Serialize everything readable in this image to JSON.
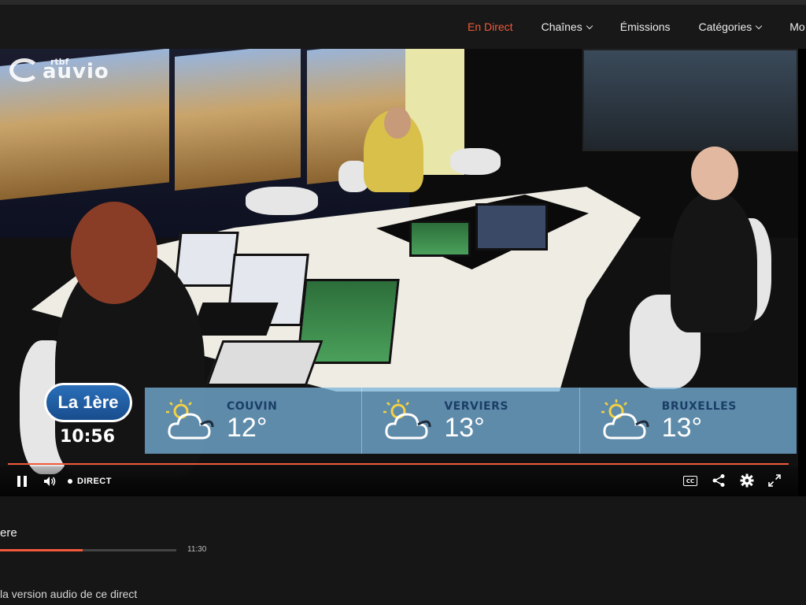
{
  "nav": {
    "items": [
      {
        "label": "En Direct",
        "active": true,
        "dropdown": false
      },
      {
        "label": "Chaînes",
        "active": false,
        "dropdown": true
      },
      {
        "label": "Émissions",
        "active": false,
        "dropdown": false
      },
      {
        "label": "Catégories",
        "active": false,
        "dropdown": true
      },
      {
        "label": "Mo",
        "active": false,
        "dropdown": false
      }
    ]
  },
  "logo": {
    "brand": "auvio",
    "sub": "rtbf"
  },
  "broadcast": {
    "channel": "La 1ère",
    "clock": "10:56",
    "weather": [
      {
        "city": "COUVIN",
        "temp": "12°",
        "icon": "partly-cloudy-icon"
      },
      {
        "city": "VERVIERS",
        "temp": "13°",
        "icon": "partly-cloudy-icon"
      },
      {
        "city": "BRUXELLES",
        "temp": "13°",
        "icon": "partly-cloudy-icon"
      }
    ]
  },
  "player": {
    "live_label": "DIRECT",
    "cc_label": "CC",
    "progress": 1.0
  },
  "program": {
    "title": "ere",
    "end_time": "11:30",
    "progress": 0.47,
    "audio_link": "la version audio de ce direct"
  },
  "colors": {
    "accent": "#f05a3a",
    "nav_bg": "#181818",
    "weather_band": "#78b4dc",
    "weather_city": "#1b3e66"
  }
}
